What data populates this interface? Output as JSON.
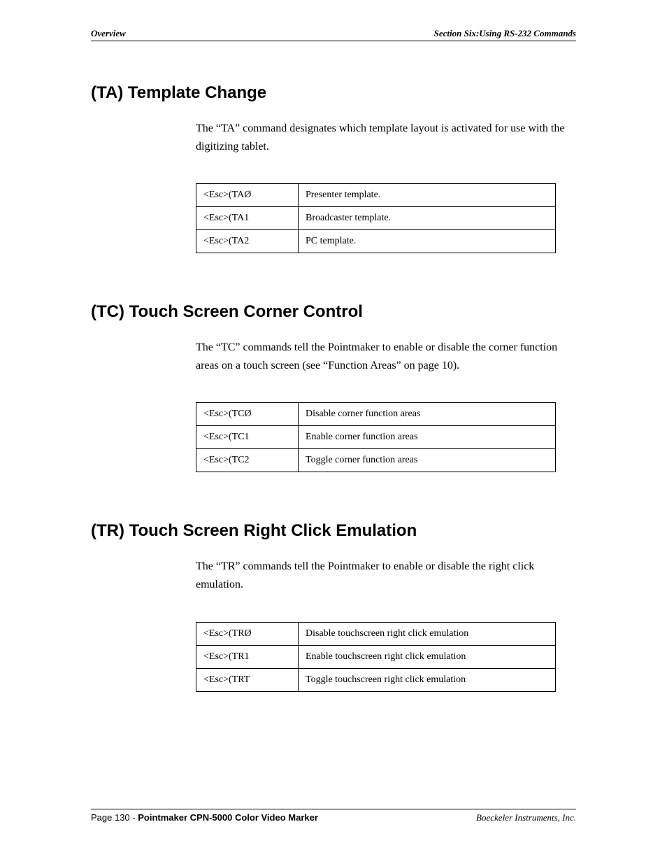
{
  "header": {
    "left": "Overview",
    "right": "Section Six:Using RS-232 Commands"
  },
  "sections": [
    {
      "heading": "(TA) Template Change",
      "body": "The “TA” command designates which template layout is activated for use with the digitizing tablet.",
      "rows": [
        {
          "cmd": "<Esc>(TAØ",
          "desc": "Presenter template."
        },
        {
          "cmd": "<Esc>(TA1",
          "desc": "Broadcaster template."
        },
        {
          "cmd": "<Esc>(TA2",
          "desc": "PC template."
        }
      ]
    },
    {
      "heading": "(TC) Touch Screen Corner Control",
      "body": "The “TC” commands tell the Pointmaker to enable or disable the corner function areas on a touch screen (see “Function Areas”  on page 10).",
      "rows": [
        {
          "cmd": "<Esc>(TCØ",
          "desc": "Disable corner function areas"
        },
        {
          "cmd": "<Esc>(TC1",
          "desc": "Enable corner function areas"
        },
        {
          "cmd": "<Esc>(TC2",
          "desc": "Toggle corner function areas"
        }
      ]
    },
    {
      "heading": "(TR) Touch Screen Right Click Emulation",
      "body": "The “TR” commands tell the Pointmaker to enable or disable the right click emulation.",
      "rows": [
        {
          "cmd": "<Esc>(TRØ",
          "desc": "Disable touchscreen right click emulation"
        },
        {
          "cmd": "<Esc>(TR1",
          "desc": "Enable touchscreen right click emulation"
        },
        {
          "cmd": "<Esc>(TRT",
          "desc": "Toggle touchscreen right click emulation"
        }
      ]
    }
  ],
  "footer": {
    "page_prefix": "Page 130 - ",
    "doc_title": "Pointmaker CPN-5000 Color Video Marker",
    "company": "Boeckeler Instruments, Inc."
  }
}
